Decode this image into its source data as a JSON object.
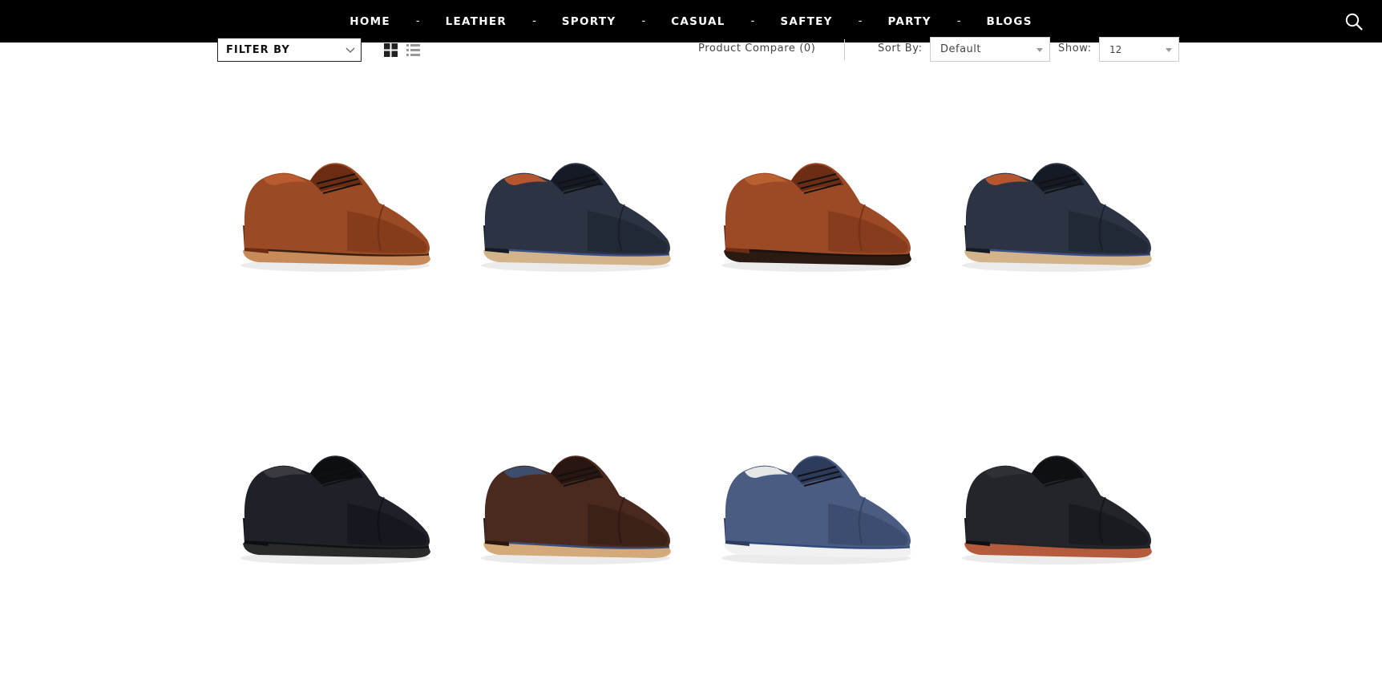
{
  "nav": {
    "items": [
      "HOME",
      "LEATHER",
      "SPORTY",
      "CASUAL",
      "SAFTEY",
      "PARTY",
      "BLOGS"
    ],
    "separator": "-",
    "search_icon": "search-icon"
  },
  "toolbar": {
    "filter_label": "FILTER BY",
    "grid_view_icon": "grid-view-icon",
    "list_view_icon": "list-view-icon",
    "compare_label": "Product Compare (0)",
    "sort_label": "Sort By:",
    "sort_value": "Default",
    "show_label": "Show:",
    "show_value": "12"
  },
  "products": [
    {
      "name": "cognac-cap-toe-oxford",
      "upper": "#9a4a24",
      "upper_dark": "#6b2c12",
      "sole": "#c98a5a",
      "welt": "#3a1f10",
      "accent": "#b85c30"
    },
    {
      "name": "navy-derby-tan-sole",
      "upper": "#2c3444",
      "upper_dark": "#151b26",
      "sole": "#d3b48a",
      "welt": "#3b4f8a",
      "accent": "#b5562e"
    },
    {
      "name": "brown-cap-toe-derby",
      "upper": "#9b4a25",
      "upper_dark": "#6d2c14",
      "sole": "#2a1a12",
      "welt": "#1a100c",
      "accent": "#b8602f"
    },
    {
      "name": "navy-derby-tan-sole-2",
      "upper": "#2c3444",
      "upper_dark": "#151b26",
      "sole": "#d3b48a",
      "welt": "#3b4f8a",
      "accent": "#b5562e"
    },
    {
      "name": "black-plain-derby",
      "upper": "#1e2128",
      "upper_dark": "#0c0e12",
      "sole": "#2a2a2a",
      "welt": "#111111",
      "accent": "#3a3a40"
    },
    {
      "name": "brown-distressed-derby",
      "upper": "#4a2a1e",
      "upper_dark": "#2a1610",
      "sole": "#d4aa7a",
      "welt": "#3a4e7c",
      "accent": "#3d4d6e"
    },
    {
      "name": "blue-suede-derby",
      "upper": "#4a5c82",
      "upper_dark": "#2d3c5c",
      "sole": "#f1f1f1",
      "welt": "#2f4a7c",
      "accent": "#e6e6e6"
    },
    {
      "name": "black-cap-toe-derby",
      "upper": "#23252b",
      "upper_dark": "#0f1014",
      "sole": "#b35b3c",
      "welt": "#222222",
      "accent": "#2f3036"
    }
  ],
  "colors": {
    "nav_bg": "#000000",
    "nav_text": "#ffffff",
    "toolbar_text": "#444444",
    "border": "#cccccc"
  }
}
